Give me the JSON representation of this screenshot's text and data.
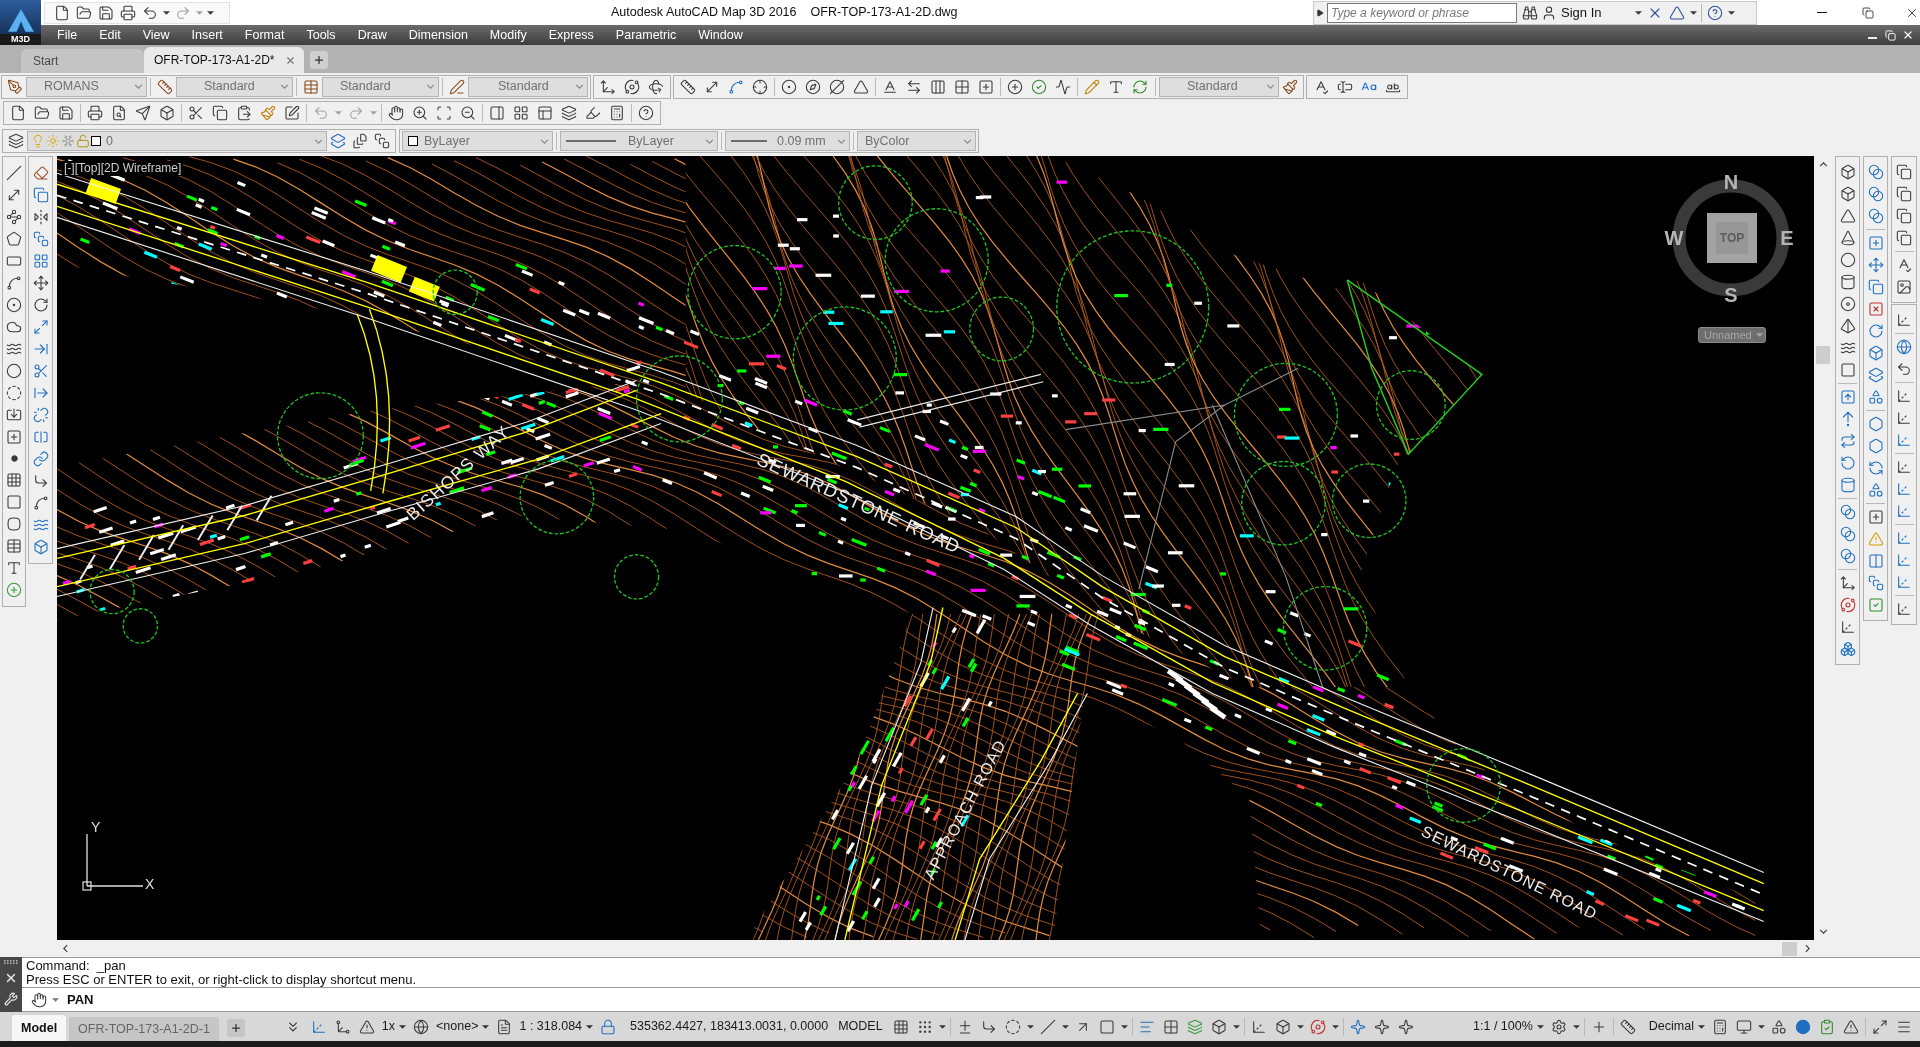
{
  "title_bar": {
    "app_badge": "M3D",
    "title": "Autodesk AutoCAD Map 3D 2016",
    "file_name": "OFR-TOP-173-A1-2D.dwg",
    "search": {
      "placeholder": "Type a keyword or phrase"
    },
    "sign_in": "Sign In"
  },
  "menu_bar": [
    "File",
    "Edit",
    "View",
    "Insert",
    "Format",
    "Tools",
    "Draw",
    "Dimension",
    "Modify",
    "Express",
    "Parametric",
    "Window"
  ],
  "file_tabs": [
    {
      "label": "Start",
      "selected": false
    },
    {
      "label": "OFR-TOP-173-A1-2D*",
      "selected": true
    }
  ],
  "styles_toolbar": {
    "text_style": "ROMANS",
    "dimension_style": "Standard",
    "table_style": "Standard",
    "multileader_style": "Standard"
  },
  "dimension_toolbar": {
    "dimension_style": "Standard"
  },
  "layers_toolbar": {
    "layer": "0"
  },
  "properties_toolbar": {
    "object_color": "ByLayer",
    "linetype": "ByLayer",
    "lineweight": "0.09 mm",
    "plot_style": "ByColor"
  },
  "viewport": {
    "label": "[-][Top][2D Wireframe]",
    "road_labels": [
      "BISHOPS WAY",
      "SEWARDSTONE ROAD",
      "APPROACH ROAD",
      "SEWARDSTONE ROAD"
    ],
    "viewcube": {
      "north": "N",
      "south": "S",
      "east": "E",
      "west": "W",
      "face": "TOP",
      "view_menu": "Unnamed"
    },
    "ucs_icon": {
      "x": "X",
      "y": "Y"
    }
  },
  "command_line": {
    "history": [
      "Command:  _pan",
      "Press ESC or ENTER to exit, or right-click to display shortcut menu."
    ],
    "input": "PAN"
  },
  "layout_tabs": [
    {
      "label": "Model",
      "selected": true
    },
    {
      "label": "OFR-TOP-173-A1-2D-1",
      "selected": false
    }
  ],
  "status_bar": {
    "annotation_scale_factor": "1x",
    "coordinate_system": "<none>",
    "viewport_scale": "1 : 318.084",
    "coordinates": "535362.4427, 183413.0031, 0.0000",
    "space": "MODEL",
    "annotation_scale": "1:1 / 100%",
    "units": "Decimal"
  }
}
